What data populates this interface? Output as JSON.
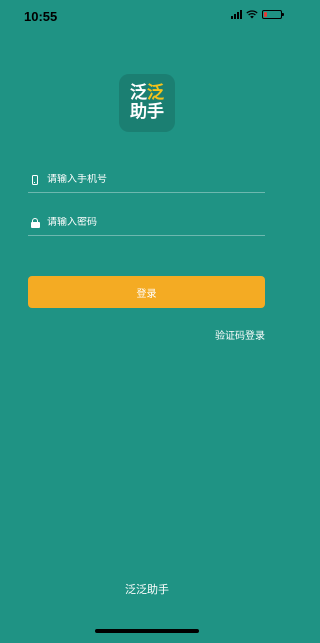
{
  "status_bar": {
    "time": "10:55",
    "icons": [
      "signal-icon",
      "wifi-icon",
      "battery-icon"
    ],
    "battery_color": "#e53935"
  },
  "logo": {
    "line1_part1": "泛",
    "line1_part2": "泛",
    "line2": "助手",
    "accent_color": "#f5c21b"
  },
  "form": {
    "phone_placeholder": "请输入手机号",
    "phone_icon": "phone-icon",
    "password_placeholder": "请输入密码",
    "password_icon": "lock-icon",
    "login_label": "登录",
    "sms_login_label": "验证码登录"
  },
  "footer": {
    "app_name": "泛泛助手"
  },
  "colors": {
    "background": "#1f9384",
    "button": "#f4ab23"
  }
}
